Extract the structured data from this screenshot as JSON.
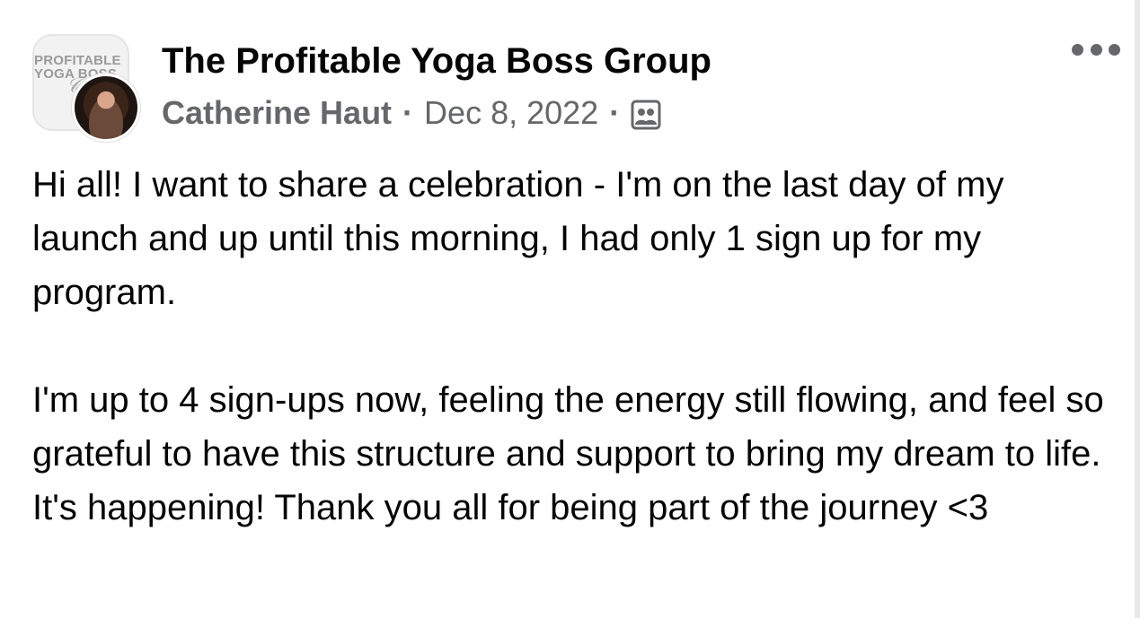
{
  "group": {
    "name": "The Profitable Yoga Boss Group",
    "logo_text": "PROFITABLE\nYOGA BOSS"
  },
  "author": {
    "name": "Catherine Haut"
  },
  "post": {
    "date": "Dec 8, 2022",
    "separator": "·",
    "audience_icon": "group-members-icon",
    "paragraphs": [
      "Hi all! I want to share a celebration - I'm on the last day of my launch and up until this morning, I had only 1 sign up for my program.",
      "I'm up to 4 sign-ups now, feeling the energy still flowing, and feel so grateful to have this structure and support to bring my dream to life. It's happening! Thank you all for being part of the journey <3"
    ]
  },
  "colors": {
    "primary_text": "#050505",
    "secondary_text": "#65676b"
  }
}
